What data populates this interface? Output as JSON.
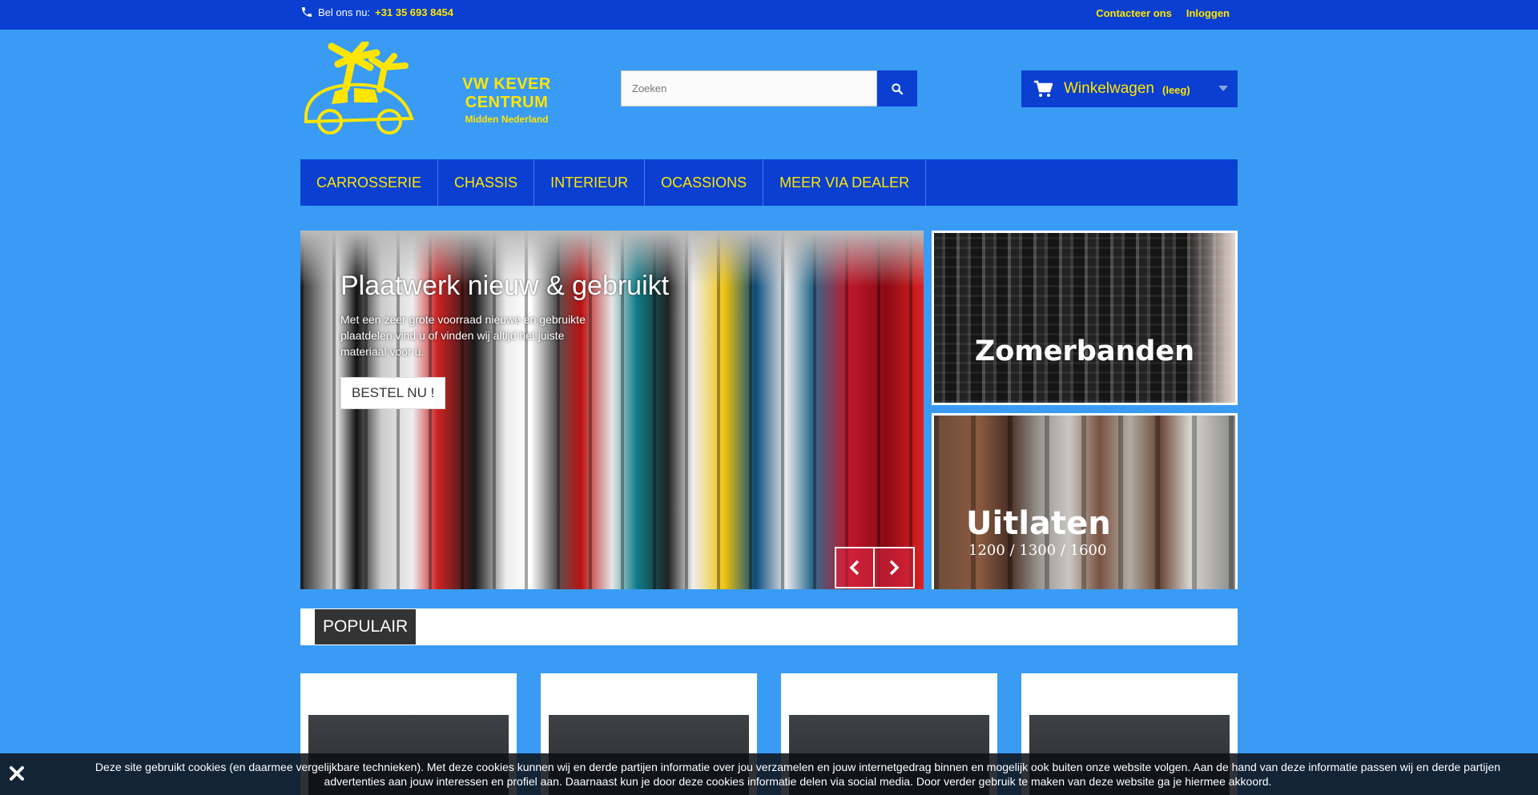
{
  "topbar": {
    "phone_label": "Bel ons nu:",
    "phone_number": "+31 35 693 8454",
    "links": [
      "Contacteer ons",
      "Inloggen"
    ]
  },
  "logo": {
    "line1": "VW KEVER CENTRUM",
    "line2": "Midden Nederland"
  },
  "search": {
    "placeholder": "Zoeken"
  },
  "cart": {
    "label": "Winkelwagen",
    "status": "(leeg)"
  },
  "menu": [
    "CARROSSERIE",
    "CHASSIS",
    "INTERIEUR",
    "OCASSIONS",
    "MEER VIA DEALER"
  ],
  "slider": {
    "title": "Plaatwerk nieuw & gebruikt",
    "text": "Met een zeer grote voorraad nieuwe en gebruikte plaatdelen vind u of vinden wij altijd het juiste materiaal voor u.",
    "button": "BESTEL NU !"
  },
  "banners": {
    "tires": "Zomerbanden",
    "exhaust_title": "Uitlaten",
    "exhaust_sub": "1200 / 1300 / 1600"
  },
  "popular": {
    "title": "POPULAIR"
  },
  "cookie": {
    "message": "Deze site gebruikt cookies (en daarmee vergelijkbare technieken). Met deze cookies kunnen wij en derde partijen informatie over jou verzamelen en jouw internetgedrag binnen en mogelijk ook buiten onze website volgen. Aan de hand van deze informatie passen wij en derde partijen advertenties aan jouw interessen en profiel aan. Daarnaast kun je door deze cookies informatie delen via social media. Door verder gebruik te maken van deze website ga je hiermee akkoord."
  },
  "colors": {
    "background": "#3a9bf5",
    "primary": "#0a3fd1",
    "accent": "#ffe600"
  }
}
